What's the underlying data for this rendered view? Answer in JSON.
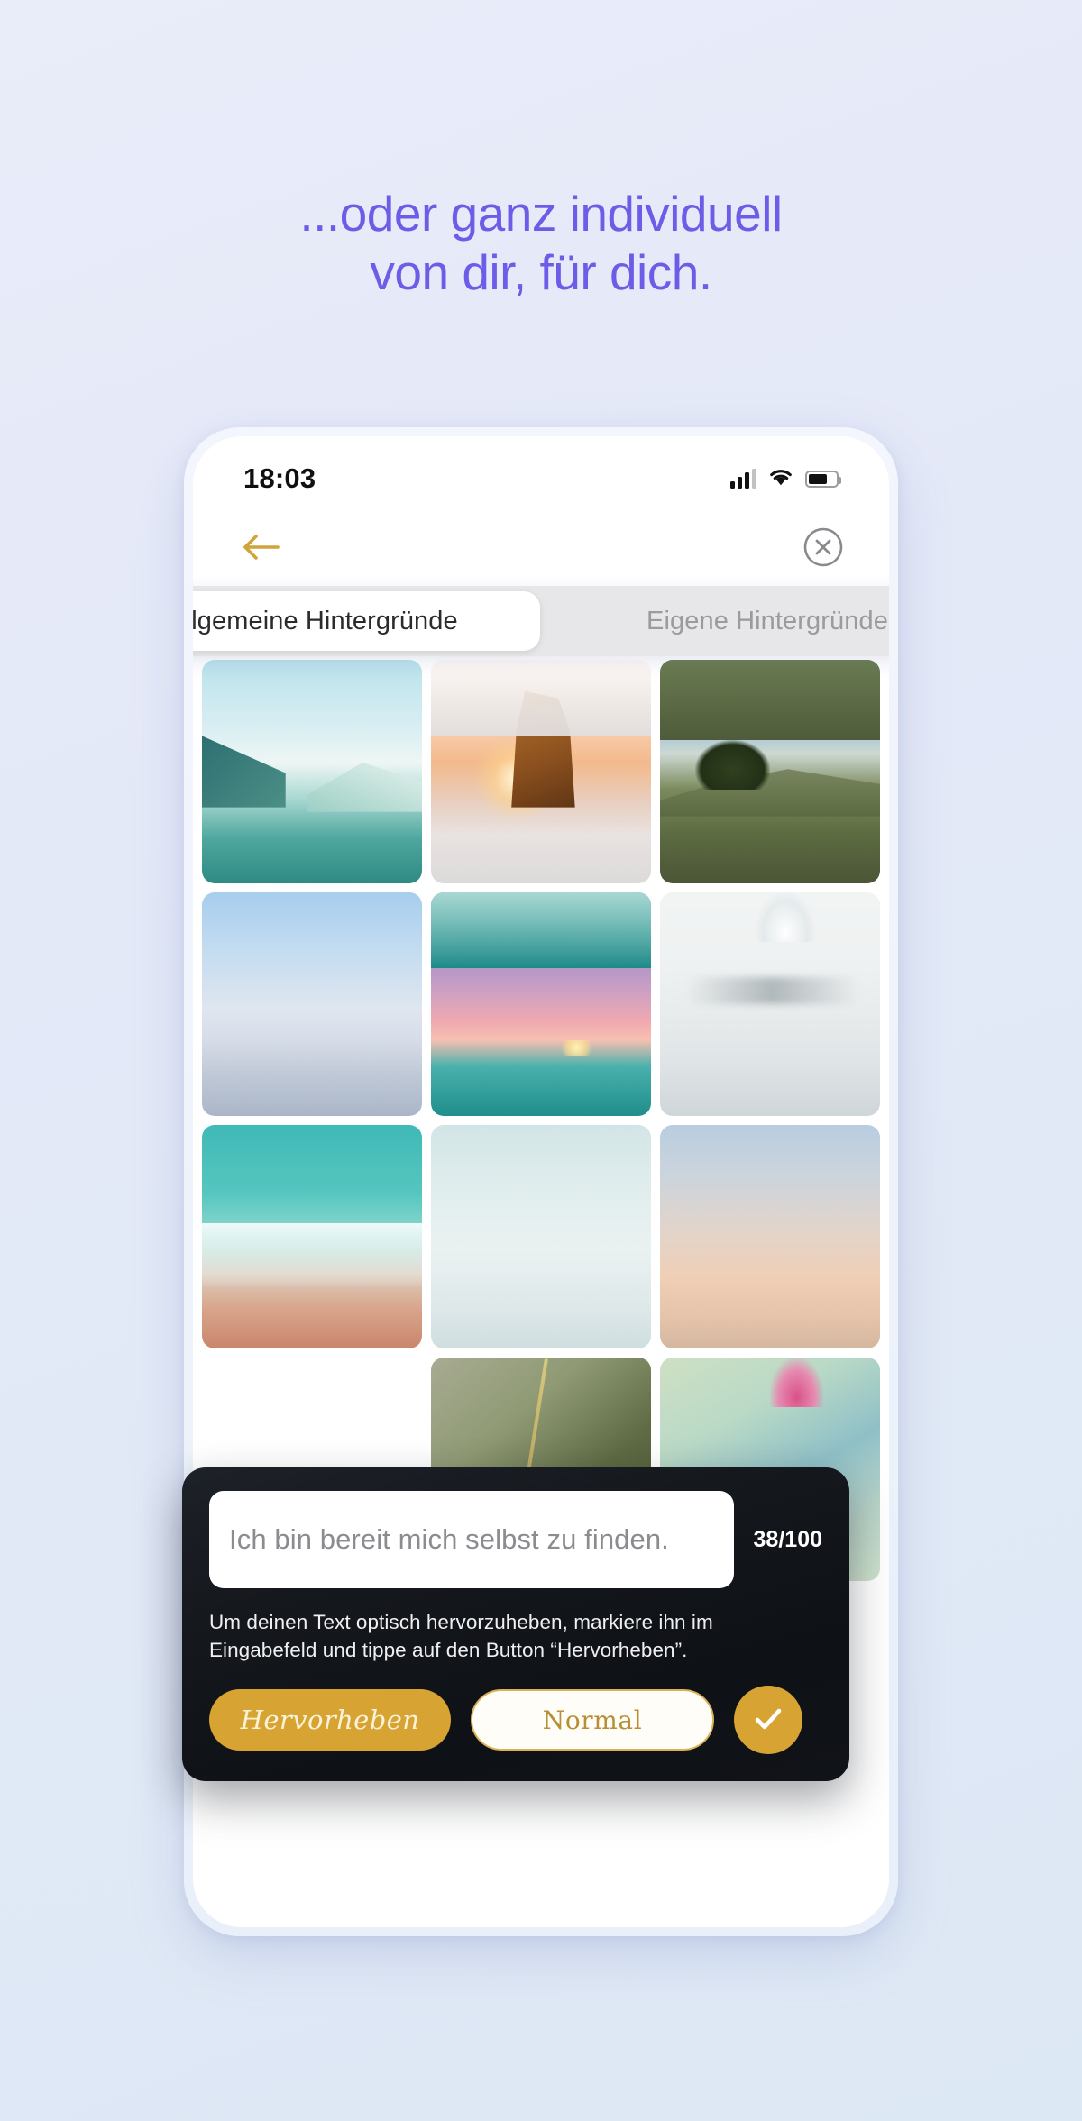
{
  "page": {
    "headline_line1": "...oder ganz individuell",
    "headline_line2": "von dir, für dich.",
    "headline_color": "#6c5ce7",
    "background_color": "#e4e9f8"
  },
  "status_bar": {
    "time": "18:03",
    "signal_icon": "cellular-signal-icon",
    "wifi_icon": "wifi-icon",
    "battery_icon": "battery-icon"
  },
  "nav_bar": {
    "back_icon": "back-arrow-icon",
    "back_color": "#cfa43a",
    "close_icon": "close-circle-icon",
    "close_color": "#8a8a8e"
  },
  "tabs": {
    "items": [
      {
        "label": "Allgemeine Hintergründe",
        "active": true
      },
      {
        "label": "Eigene Hintergründe",
        "active": false
      }
    ],
    "active_bg": "#ffffff",
    "track_bg": "#e7e7e9"
  },
  "grid": {
    "tiles": [
      {
        "name": "mountain-lake-wallpaper",
        "alt": "Bergsee mit Spiegelung"
      },
      {
        "name": "sunset-rock-wallpaper",
        "alt": "Sonnenuntergang am Felsen"
      },
      {
        "name": "hillside-wallpaper",
        "alt": "Hügel mit Baum"
      },
      {
        "name": "calm-sea-wallpaper",
        "alt": "Ruhige blaue See"
      },
      {
        "name": "dusk-waves-wallpaper",
        "alt": "Rosa Sonnenuntergang über Wellen"
      },
      {
        "name": "misty-lake-wallpaper",
        "alt": "Nebliger See"
      },
      {
        "name": "turquoise-beach-wallpaper",
        "alt": "Türkisfarbener Strand"
      },
      {
        "name": "pale-ice-wallpaper",
        "alt": "Blasses Eis"
      },
      {
        "name": "peach-gradient-wallpaper",
        "alt": "Pfirsich-Blau Verlauf"
      },
      {
        "name": "pink-flower-wallpaper",
        "alt": "Pinke Blüte"
      },
      {
        "name": "green-plant-wallpaper",
        "alt": "Grüne Pflanze"
      },
      {
        "name": "lily-wallpaper",
        "alt": "Seerose"
      }
    ]
  },
  "modal": {
    "input_value": "Ich bin bereit mich selbst zu finden.",
    "input_placeholder": "Ich bin bereit mich selbst zu finden.",
    "char_count": "38/100",
    "hint": "Um deinen Text optisch hervorzuheben, markiere ihn im Eingabefeld und tippe auf den Button “Hervorheben”.",
    "highlight_label": "Hervorheben",
    "normal_label": "Normal",
    "confirm_icon": "checkmark-icon",
    "accent_color": "#d7a433",
    "background_color": "#13161b"
  }
}
